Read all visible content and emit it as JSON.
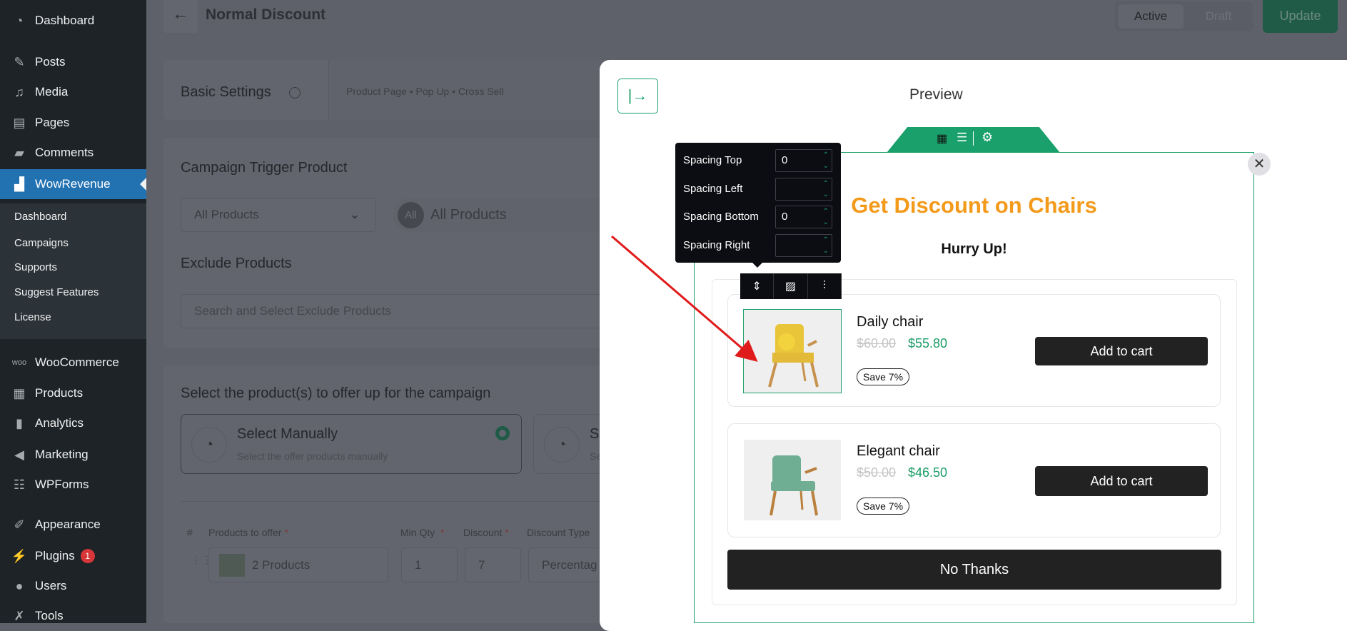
{
  "sidebar": {
    "items": [
      {
        "label": "Dashboard",
        "icon": "dashboard-icon"
      },
      {
        "label": "Posts",
        "icon": "pin-icon"
      },
      {
        "label": "Media",
        "icon": "media-icon"
      },
      {
        "label": "Pages",
        "icon": "pages-icon"
      },
      {
        "label": "Comments",
        "icon": "comment-icon"
      },
      {
        "label": "WowRevenue",
        "icon": "wowrevenue-icon"
      },
      {
        "label": "WooCommerce",
        "icon": "woo-icon"
      },
      {
        "label": "Products",
        "icon": "box-icon"
      },
      {
        "label": "Analytics",
        "icon": "bar-chart-icon"
      },
      {
        "label": "Marketing",
        "icon": "megaphone-icon"
      },
      {
        "label": "WPForms",
        "icon": "form-icon"
      },
      {
        "label": "Appearance",
        "icon": "brush-icon"
      },
      {
        "label": "Plugins",
        "icon": "plug-icon",
        "badge": "1"
      },
      {
        "label": "Users",
        "icon": "user-icon"
      },
      {
        "label": "Tools",
        "icon": "wrench-icon"
      }
    ],
    "submenu": [
      "Dashboard",
      "Campaigns",
      "Supports",
      "Suggest Features",
      "License"
    ]
  },
  "header": {
    "title": "Normal Discount",
    "status_active": "Active",
    "status_draft": "Draft",
    "update": "Update"
  },
  "basic": {
    "title": "Basic Settings",
    "tabs": "Product Page • Pop Up • Cross Sell"
  },
  "trigger": {
    "title": "Campaign Trigger Product",
    "select": "All Products",
    "chip_icon": "All",
    "chip": "All Products",
    "exclude_title": "Exclude Products",
    "exclude_placeholder": "Search and Select Exclude Products"
  },
  "offer": {
    "title": "Select the product(s) to offer up for the campaign",
    "manual_title": "Select Manually",
    "manual_desc": "Select the offer products manually",
    "second_title": "Se",
    "second_desc": "Se"
  },
  "table": {
    "headers": [
      "#",
      "Products to offer",
      "Min Qty",
      "Discount",
      "Discount Type"
    ],
    "row": {
      "products": "2 Products",
      "min_qty": "1",
      "discount": "7",
      "type": "Percentag"
    }
  },
  "preview": {
    "title": "Preview",
    "popup_title": "Get Discount on Chairs",
    "subtitle": "Hurry Up!",
    "no_thanks": "No Thanks",
    "title_color": "#f39a1a",
    "accent": "#1aa06a",
    "products": [
      {
        "name": "Daily chair",
        "old_price": "$60.00",
        "price": "$55.80",
        "save": "Save 7%",
        "cta": "Add to cart"
      },
      {
        "name": "Elegant chair",
        "old_price": "$50.00",
        "price": "$46.50",
        "save": "Save 7%",
        "cta": "Add to cart"
      }
    ]
  },
  "spacing": {
    "rows": [
      {
        "label": "Spacing Top",
        "value": "0"
      },
      {
        "label": "Spacing Left",
        "value": ""
      },
      {
        "label": "Spacing Bottom",
        "value": "0"
      },
      {
        "label": "Spacing Right",
        "value": ""
      }
    ]
  }
}
